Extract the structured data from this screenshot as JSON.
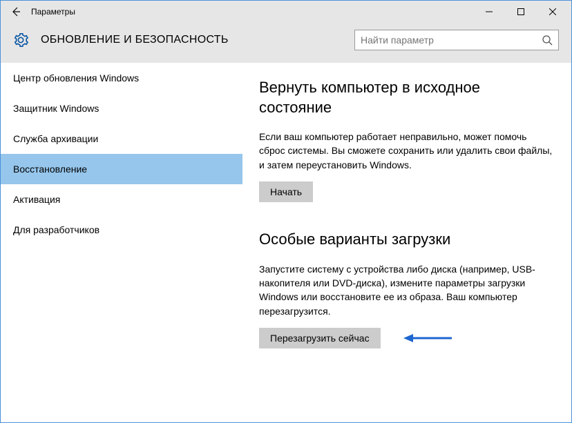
{
  "window_title": "Параметры",
  "header_title": "ОБНОВЛЕНИЕ И БЕЗОПАСНОСТЬ",
  "search_placeholder": "Найти параметр",
  "sidebar": {
    "items": [
      {
        "label": "Центр обновления Windows"
      },
      {
        "label": "Защитник Windows"
      },
      {
        "label": "Служба архивации"
      },
      {
        "label": "Восстановление"
      },
      {
        "label": "Активация"
      },
      {
        "label": "Для разработчиков"
      }
    ]
  },
  "sections": {
    "reset": {
      "title": "Вернуть компьютер в исходное состояние",
      "desc": "Если ваш компьютер работает неправильно, может помочь сброс системы. Вы сможете сохранить или удалить свои файлы, и затем переустановить Windows.",
      "button": "Начать"
    },
    "advanced": {
      "title": "Особые варианты загрузки",
      "desc": "Запустите систему с устройства либо диска (например, USB-накопителя или DVD-диска), измените параметры загрузки Windows или восстановите ее из образа. Ваш компьютер перезагрузится.",
      "button": "Перезагрузить сейчас"
    }
  }
}
